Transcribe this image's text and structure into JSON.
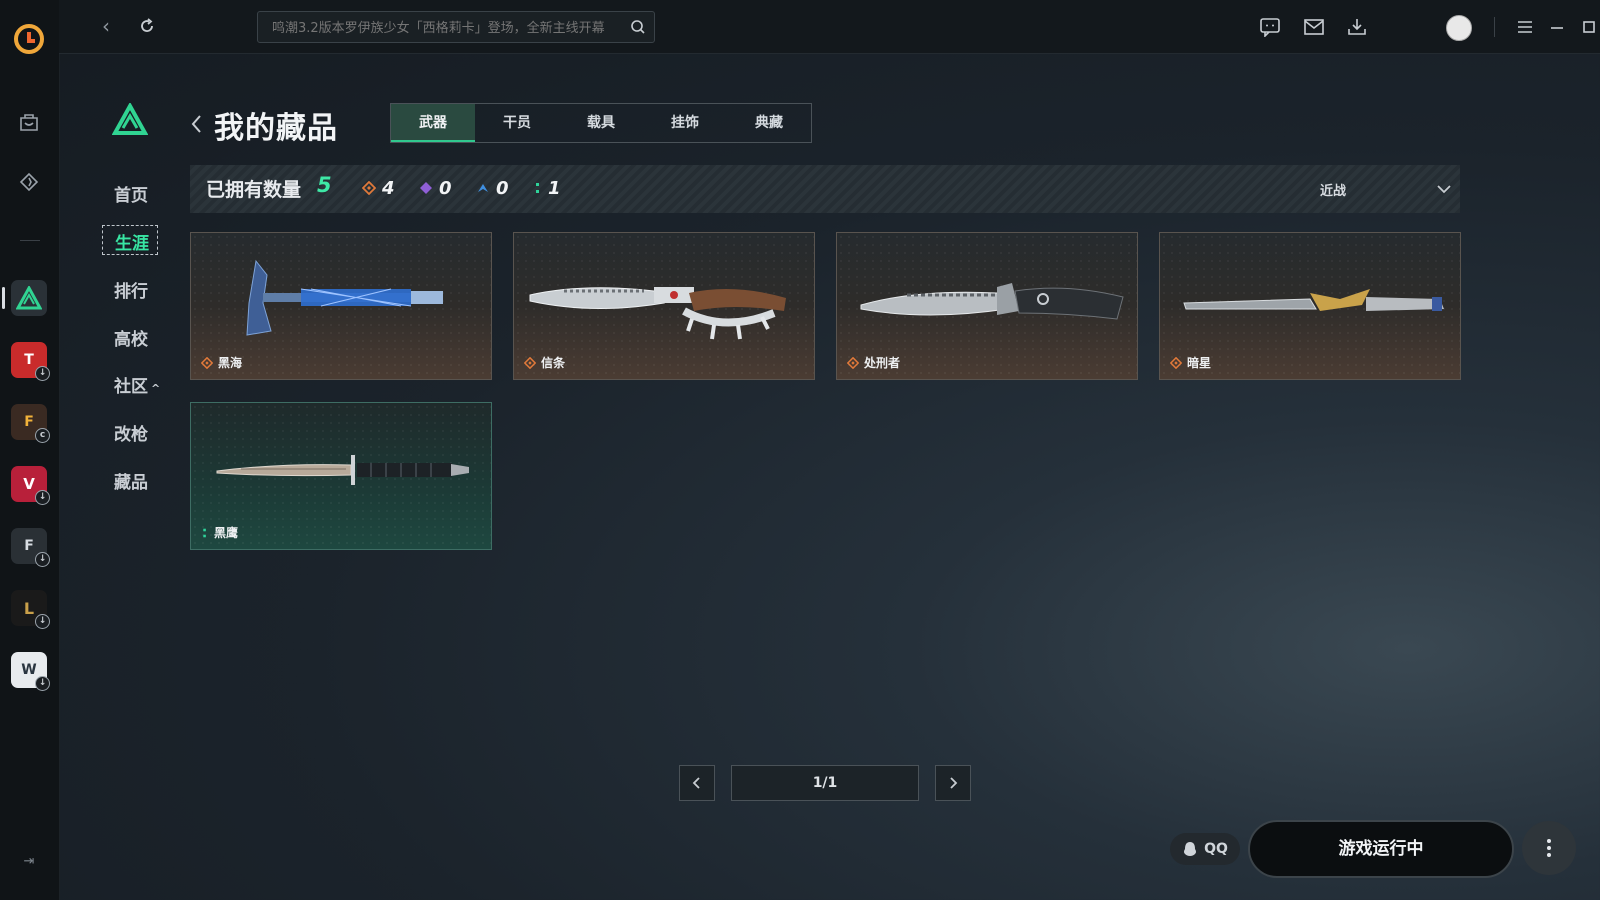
{
  "topbar": {
    "search_placeholder": "鸣潮3.2版本罗伊族少女「西格莉卡」登场，全新主线开幕"
  },
  "section_nav": {
    "items": [
      "首页",
      "生涯",
      "排行",
      "高校",
      "社区",
      "改枪",
      "藏品"
    ],
    "active": "生涯"
  },
  "header": {
    "title": "我的藏品",
    "tabs": [
      "武器",
      "干员",
      "载具",
      "挂饰",
      "典藏"
    ],
    "active_tab": "武器"
  },
  "summary": {
    "label": "已拥有数量",
    "total": "5",
    "rarities": [
      {
        "name": "orange",
        "count": "4",
        "color": "#e0793a"
      },
      {
        "name": "purple",
        "count": "0",
        "color": "#8f5fd6"
      },
      {
        "name": "blue",
        "count": "0",
        "color": "#3f8fe0"
      },
      {
        "name": "green",
        "count": "1",
        "color": "#2ed39a"
      }
    ],
    "filter": "近战"
  },
  "items": [
    {
      "name": "黑海",
      "rarity": "orange"
    },
    {
      "name": "信条",
      "rarity": "orange"
    },
    {
      "name": "处刑者",
      "rarity": "orange"
    },
    {
      "name": "暗星",
      "rarity": "orange"
    },
    {
      "name": "黑鹰",
      "rarity": "green"
    }
  ],
  "pagination": {
    "label": "1/1"
  },
  "bottom": {
    "qq_label": "QQ",
    "run_label": "游戏运行中"
  },
  "colors": {
    "accent": "#30c88e",
    "orange": "#e0793a",
    "green": "#2ed39a"
  }
}
